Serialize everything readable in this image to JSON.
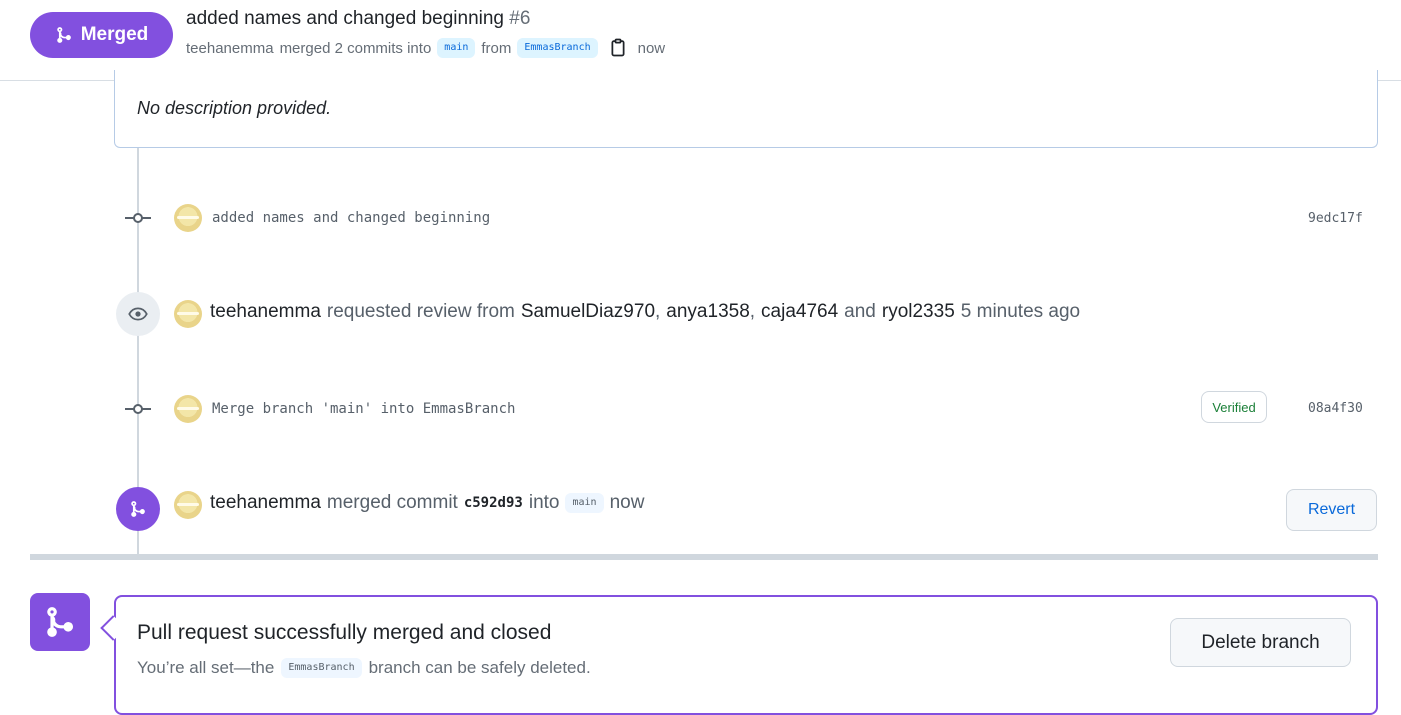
{
  "header": {
    "status_badge": "Merged",
    "pr_title": "added names and changed beginning",
    "pr_number": "#6",
    "author": "teehanemma",
    "merged_text": "merged 2 commits into",
    "base_branch": "main",
    "from_text": "from",
    "head_branch": "EmmasBranch",
    "time": "now"
  },
  "description": {
    "text": "No description provided."
  },
  "timeline": {
    "commit1": {
      "message": "added names and changed beginning",
      "sha": "9edc17f"
    },
    "review_request": {
      "actor": "teehanemma",
      "text": "requested review from",
      "reviewers": [
        "SamuelDiaz970",
        "anya1358",
        "caja4764",
        "ryol2335"
      ],
      "and_text": "and",
      "time": "5 minutes ago"
    },
    "commit2": {
      "message": "Merge branch 'main' into EmmasBranch",
      "verified": "Verified",
      "sha": "08a4f30"
    },
    "merge_event": {
      "actor": "teehanemma",
      "text": "merged commit",
      "commit": "c592d93",
      "into_text": "into",
      "branch": "main",
      "time": "now",
      "revert_label": "Revert"
    }
  },
  "merge_box": {
    "title": "Pull request successfully merged and closed",
    "sub_prefix": "You’re all set—the",
    "branch": "EmmasBranch",
    "sub_suffix": "branch can be safely deleted.",
    "delete_label": "Delete branch"
  },
  "icons": {
    "merge": "git-merge-icon",
    "copy": "copy-icon",
    "eye": "eye-icon",
    "commit": "git-commit-icon"
  },
  "colors": {
    "merged": "#8250df",
    "link": "#0969da",
    "verified": "#1a7f37"
  }
}
